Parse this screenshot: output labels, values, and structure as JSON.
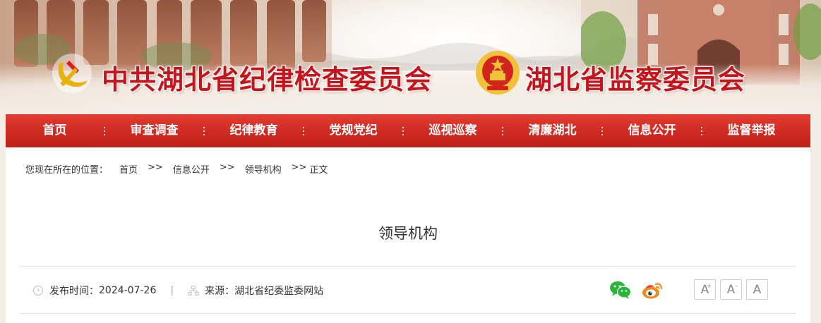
{
  "banner": {
    "title_left": "中共湖北省纪律检查委员会",
    "title_right": "湖北省监察委员会",
    "left_emblem": "party-emblem",
    "right_emblem": "national-emblem"
  },
  "nav": {
    "items": [
      "首页",
      "审查调查",
      "纪律教育",
      "党规党纪",
      "巡视巡察",
      "清廉湖北",
      "信息公开",
      "监督举报"
    ]
  },
  "breadcrumb": {
    "prefix": "您现在所在的位置：",
    "items": [
      "首页",
      "信息公开",
      "领导机构",
      "正文"
    ],
    "separator": ">>"
  },
  "article": {
    "title": "领导机构",
    "publish_label": "发布时间：",
    "publish_date": "2024-07-26",
    "divider": "|",
    "source_label": "来源：",
    "source": "湖北省纪委监委网站"
  },
  "share": {
    "icons": [
      "wechat-icon",
      "weibo-icon"
    ]
  },
  "font_size": {
    "increase": "A",
    "decrease": "A",
    "reset": "A",
    "increase_mark": "+",
    "decrease_mark": "-"
  },
  "colors": {
    "brand_red": "#c4151c",
    "nav_red": "#d42d24",
    "wechat_green": "#2ab43a",
    "weibo_orange": "#f08c1e"
  }
}
